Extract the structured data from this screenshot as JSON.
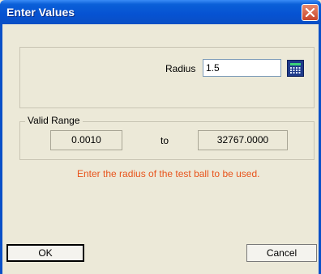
{
  "dialog": {
    "title": "Enter Values"
  },
  "radius": {
    "label": "Radius",
    "value": "1.5"
  },
  "valid_range": {
    "legend": "Valid Range",
    "min": "0.0010",
    "to": "to",
    "max": "32767.0000"
  },
  "hint": "Enter the radius of the test ball to be used.",
  "buttons": {
    "ok": "OK",
    "cancel": "Cancel"
  },
  "icons": {
    "close": "close-icon",
    "calculator": "calculator-icon"
  },
  "colors": {
    "titlebar": "#0a5fd8",
    "dialog_bg": "#ece9d8",
    "hint": "#e8541c",
    "close_button": "#c8452a"
  }
}
